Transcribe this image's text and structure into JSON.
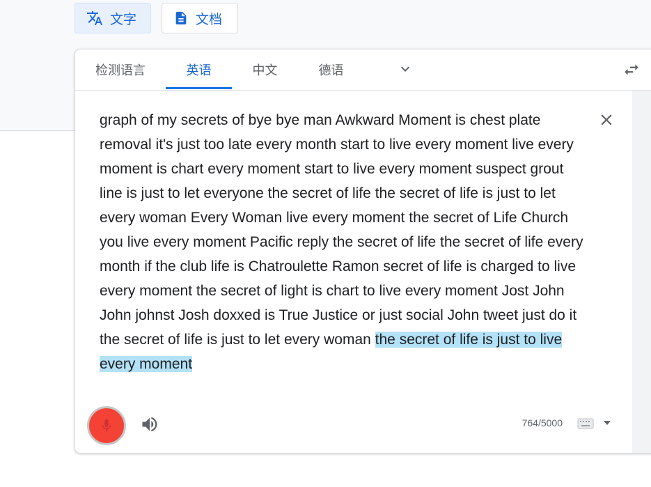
{
  "modes": {
    "text_label": "文字",
    "doc_label": "文档"
  },
  "languages": {
    "tabs": [
      "检测语言",
      "英语",
      "中文",
      "德语"
    ],
    "active_tab": "英语"
  },
  "source": {
    "text_plain": "graph of my secrets of bye bye man Awkward Moment is chest plate removal it's just too late every month start to live every moment live every moment is chart every moment start to live every moment suspect grout line is just to let everyone the secret of life the secret of life is just to let every woman Every Woman live every moment the secret of Life Church you live every moment Pacific reply the secret of life the secret of life every month if the club life is Chatroulette Ramon secret of life is charged to live every moment the secret of light is chart to live every moment Jost John John johnst Josh doxxed is True Justice or just social John tweet just do it the secret of life is just to let every woman ",
    "text_highlighted": "the secret of life is just to live every moment",
    "char_count": "764/5000"
  },
  "icons": {
    "mode_text": "translate-icon",
    "mode_doc": "document-icon",
    "more": "chevron-down-icon",
    "swap": "swap-languages-icon",
    "clear": "close-icon",
    "mic": "microphone-icon",
    "speaker": "speaker-icon",
    "keyboard": "keyboard-icon",
    "keyboard_menu": "dropdown-triangle-icon"
  },
  "colors": {
    "accent": "#1a73e8",
    "mic_active": "#f44336",
    "highlight": "#b3e1f6"
  }
}
